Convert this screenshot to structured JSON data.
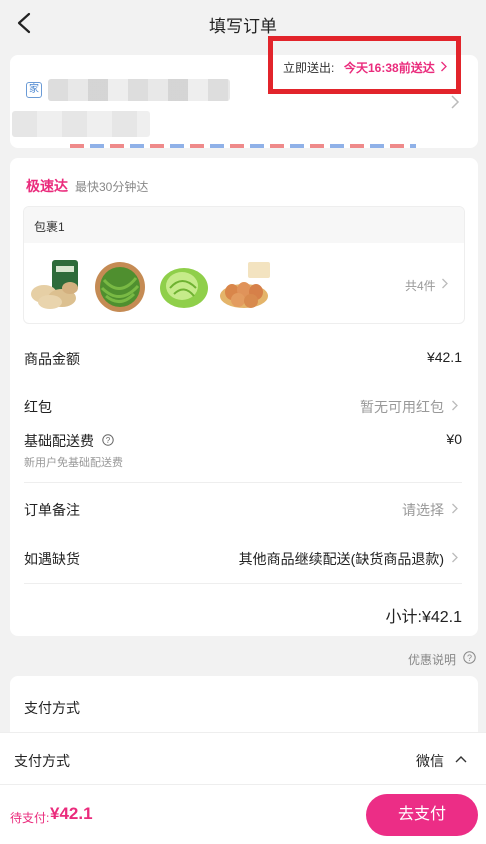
{
  "header": {
    "title": "填写订单"
  },
  "address": {
    "tag": "家"
  },
  "express": {
    "title": "极速达",
    "subtitle": "最快30分钟达",
    "package_label": "包裹1",
    "delivery_label": "立即送出:",
    "delivery_time": "今天16:38前送达",
    "item_count": "共4件",
    "products": [
      {
        "icon": "sliced-tofu-product"
      },
      {
        "icon": "green-beans-product"
      },
      {
        "icon": "lettuce-product"
      },
      {
        "icon": "eggs-product"
      }
    ]
  },
  "summary": {
    "goods_label": "商品金额",
    "goods_value": "¥42.1",
    "redpacket_label": "红包",
    "redpacket_value": "暂无可用红包",
    "delivery_fee_label": "基础配送费",
    "delivery_fee_value": "¥0",
    "delivery_fee_note": "新用户免基础配送费",
    "remark_label": "订单备注",
    "remark_value": "请选择",
    "shortage_label": "如遇缺货",
    "shortage_value": "其他商品继续配送(缺货商品退款)",
    "subtotal": "小计:¥42.1"
  },
  "discount_note": "优惠说明",
  "pay_card": {
    "label": "支付方式"
  },
  "pay_method": {
    "label": "支付方式",
    "value": "微信"
  },
  "footer": {
    "due_label": "待支付:",
    "due_amount": "¥42.1",
    "pay_button": "去支付"
  },
  "colors": {
    "accent": "#ea2b7c",
    "button": "#ec2d86",
    "highlight_border": "#e2242b"
  }
}
